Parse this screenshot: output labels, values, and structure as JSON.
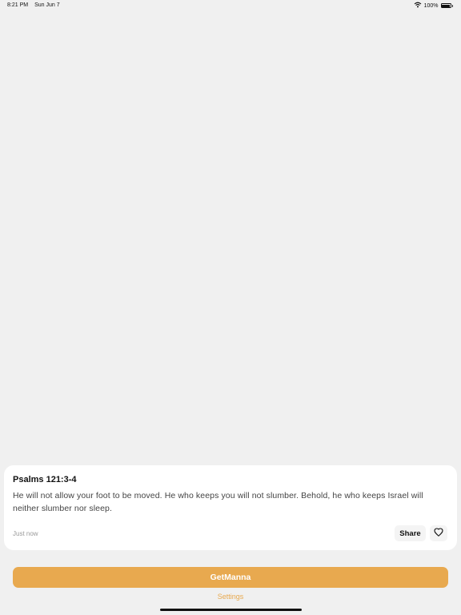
{
  "status": {
    "time": "8:21 PM",
    "date": "Sun Jun 7",
    "battery": "100%",
    "battery_level": 1.0,
    "icons": [
      "wifi-icon",
      "battery-icon"
    ]
  },
  "verse_card": {
    "reference": "Psalms 121:3-4",
    "text": "He will not allow your foot to be moved. He who keeps you will not slumber. Behold, he who keeps Israel will neither slumber nor sleep.",
    "timestamp": "Just now",
    "share_label": "Share",
    "like_icon": "heart-icon"
  },
  "actions": {
    "primary_label": "GetManna",
    "settings_label": "Settings"
  },
  "colors": {
    "accent": "#e8a94f",
    "background": "#f0f0f0",
    "card": "#ffffff"
  }
}
